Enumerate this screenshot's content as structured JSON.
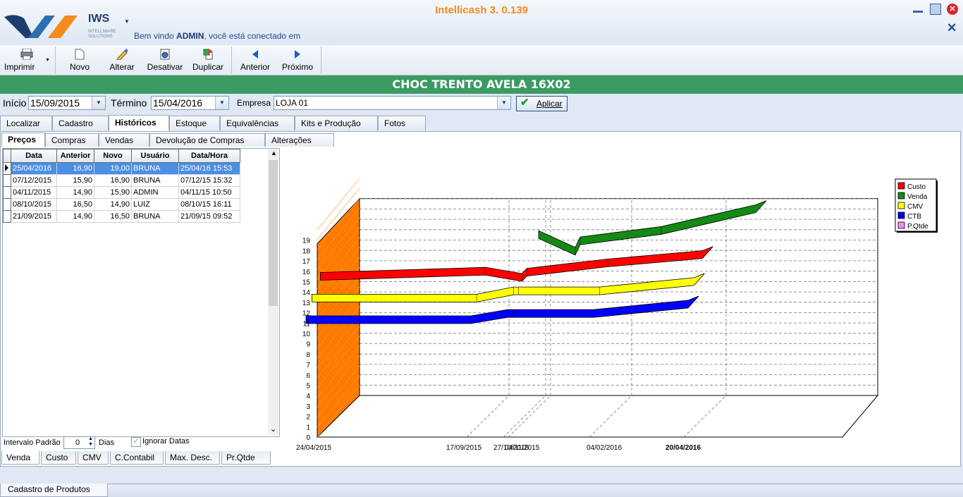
{
  "app": {
    "title": "Intellicash 3. 0.139",
    "brand": "IWS",
    "brand_sub": "INTELLIWARE SOLUTIONS",
    "welcome_prefix": "Bem vindo ",
    "user": "ADMIN",
    "welcome_suffix": ", você está conectado em"
  },
  "toolbar": {
    "imprimir": "Imprimir",
    "novo": "Novo",
    "alterar": "Alterar",
    "desativar": "Desativar",
    "duplicar": "Duplicar",
    "anterior": "Anterior",
    "proximo": "Próximo"
  },
  "product_name": "CHOC TRENTO AVELA 16X02",
  "filters": {
    "inicio_label": "Início",
    "inicio_value": "15/09/2015",
    "termino_label": "Término",
    "termino_value": "15/04/2016",
    "empresa_label": "Empresa",
    "empresa_value": "LOJA 01",
    "aplicar": "Aplicar"
  },
  "tabs": [
    "Localizar",
    "Cadastro",
    "Históricos",
    "Estoque",
    "Equivalências",
    "Kits e Produção",
    "Fotos"
  ],
  "subtabs": [
    "Preços",
    "Compras",
    "Vendas",
    "Devolução de Compras",
    "Alterações"
  ],
  "grid": {
    "headers": [
      "Data",
      "Anterior",
      "Novo",
      "Usuário",
      "Data/Hora"
    ],
    "rows": [
      [
        "25/04/2016",
        "16,90",
        "19,00",
        "BRUNA",
        "25/04/16 15:53"
      ],
      [
        "07/12/2015",
        "15,90",
        "16,90",
        "BRUNA",
        "07/12/15 15:32"
      ],
      [
        "04/11/2015",
        "14,90",
        "15,90",
        "ADMIN",
        "04/11/15 10:50"
      ],
      [
        "08/10/2015",
        "16,50",
        "14,90",
        "LUIZ",
        "08/10/15 16:11"
      ],
      [
        "21/09/2015",
        "14,90",
        "16,50",
        "BRUNA",
        "21/09/15 09:52"
      ]
    ]
  },
  "bottom": {
    "intervalo_label": "Intervalo Padrão",
    "intervalo_value": "0",
    "dias_label": "Dias",
    "ignorar_label": "Ignorar Datas",
    "tabs": [
      "Venda",
      "Custo",
      "CMV",
      "C.Contabil",
      "Max. Desc.",
      "Pr.Qtde"
    ]
  },
  "status_tab": "Cadastro de Produtos",
  "colors": {
    "accent_green": "#3a9b63",
    "title_orange": "#f58a1f",
    "custo": "#ff0000",
    "venda": "#138a13",
    "cmv": "#ffff00",
    "ctb": "#0000ff",
    "pqtde": "#ff88ff",
    "wall": "#ff7a00"
  },
  "chart_data": {
    "type": "line",
    "ylim": [
      0,
      19
    ],
    "yticks": [
      "0",
      "1",
      "2",
      "3",
      "4",
      "5",
      "6",
      "7",
      "8",
      "9",
      "10",
      "11",
      "12",
      "13",
      "14",
      "15",
      "16",
      "17",
      "18",
      "19"
    ],
    "xtick_labels": [
      "24/04/2015",
      "17/09/2015",
      "27/10/2015",
      "04/11/2015",
      "04/02/2016",
      "20/04/2016"
    ],
    "legend": [
      "Custo",
      "Venda",
      "CMV",
      "CTB",
      "P.Qtde"
    ],
    "series": [
      {
        "name": "Venda",
        "x": [
          "17/09/2015",
          "27/10/2015",
          "04/11/2015",
          "04/02/2016",
          "20/04/2016"
        ],
        "values": [
          16.5,
          14.9,
          15.9,
          16.9,
          19.0
        ]
      },
      {
        "name": "Custo",
        "x": [
          "24/04/2015",
          "17/09/2015",
          "27/10/2015",
          "04/11/2015",
          "04/02/2016",
          "20/04/2016"
        ],
        "values": [
          15.0,
          15.5,
          14.9,
          15.4,
          16.3,
          17.1
        ]
      },
      {
        "name": "CMV",
        "x": [
          "24/04/2015",
          "17/09/2015",
          "27/10/2015",
          "04/11/2015",
          "04/02/2016",
          "20/04/2016"
        ],
        "values": [
          13.3,
          13.3,
          14.0,
          14.0,
          14.0,
          14.9
        ]
      },
      {
        "name": "CTB",
        "x": [
          "24/04/2015",
          "17/09/2015",
          "27/10/2015",
          "04/11/2015",
          "04/02/2016",
          "20/04/2016"
        ],
        "values": [
          11.5,
          11.5,
          12.1,
          12.1,
          12.1,
          13.0
        ]
      }
    ]
  }
}
